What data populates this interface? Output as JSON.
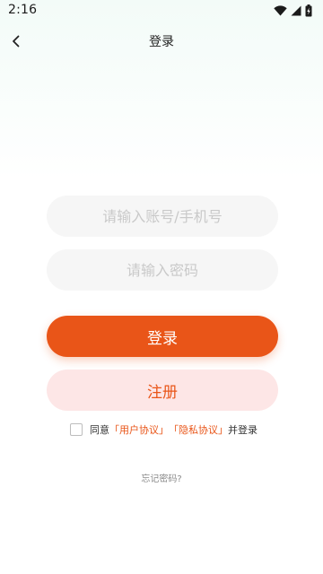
{
  "status_bar": {
    "time": "2:16",
    "icons": [
      "wifi-icon",
      "cell-signal-icon",
      "battery-icon"
    ]
  },
  "app_bar": {
    "title": "登录",
    "back_icon": "chevron-left-icon"
  },
  "form": {
    "account_placeholder": "请输入账号/手机号",
    "account_value": "",
    "password_placeholder": "请输入密码",
    "password_value": ""
  },
  "buttons": {
    "login_label": "登录",
    "register_label": "注册"
  },
  "agreement": {
    "checked": false,
    "prefix": "同意",
    "user_agreement": "「用户协议」",
    "privacy_policy": "「隐私协议」",
    "suffix": "并登录"
  },
  "forgot_password": "忘记密码?",
  "colors": {
    "accent": "#e95518",
    "register_bg": "#fde6e6",
    "input_bg": "#f6f6f6"
  }
}
